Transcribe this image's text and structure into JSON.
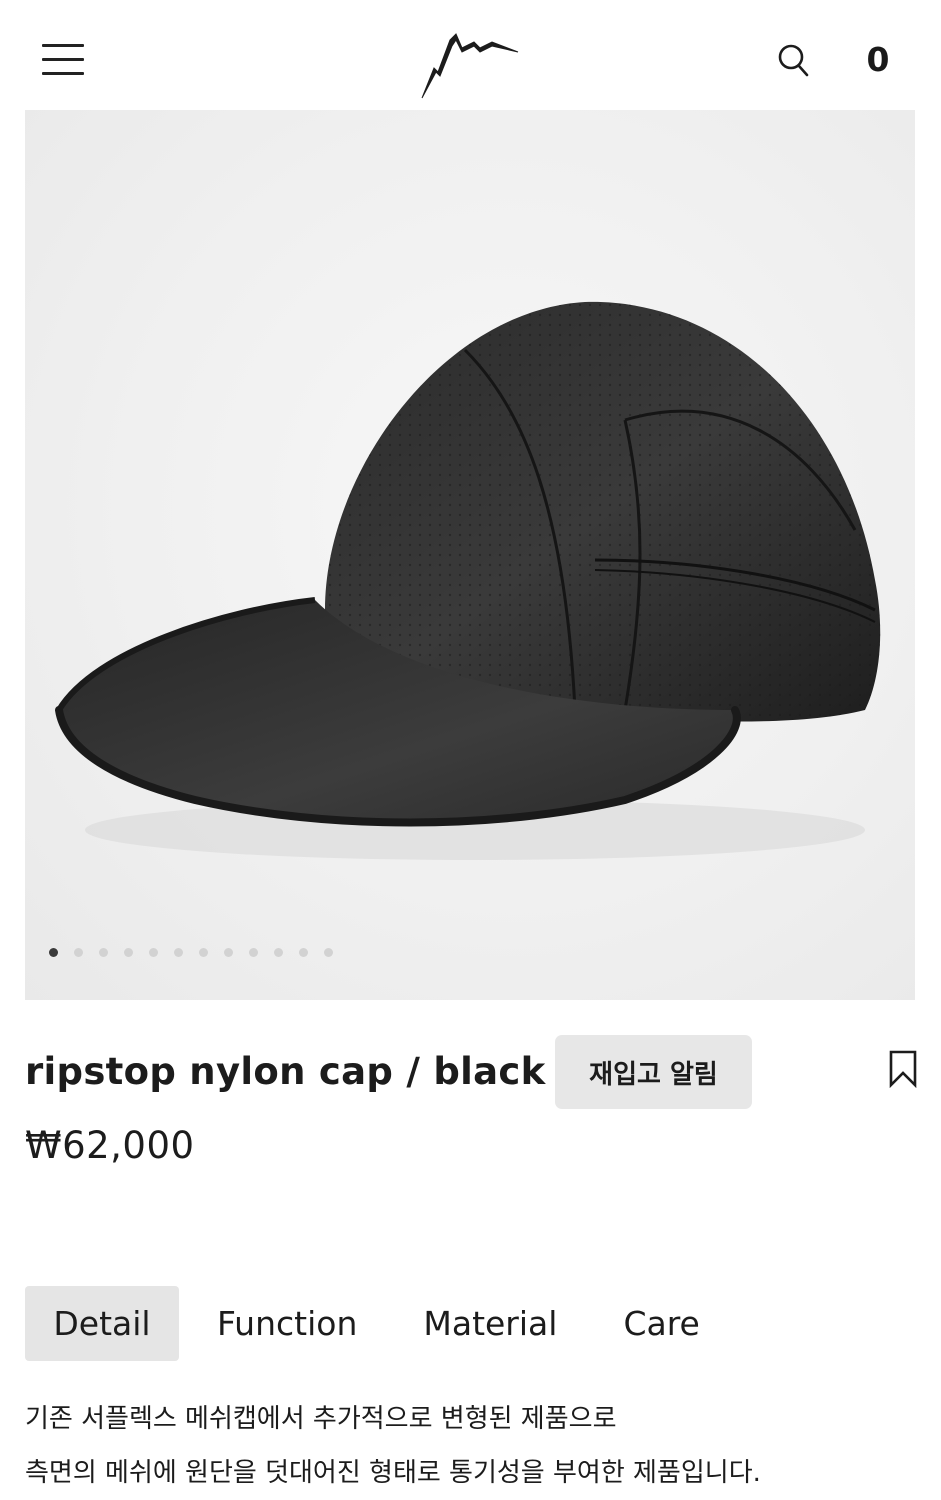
{
  "header": {
    "menu_icon": "hamburger-menu-icon",
    "logo_icon": "mountain-logo-icon",
    "search_icon": "search-icon",
    "cart_count": "0"
  },
  "product": {
    "image_alt": "black ripstop nylon cap",
    "carousel_total": 12,
    "carousel_active": 1,
    "title": "ripstop nylon cap / black",
    "restock_label": "재입고 알림",
    "bookmark_icon": "bookmark-icon",
    "price": "₩62,000"
  },
  "tabs": [
    {
      "label": "Detail",
      "active": true
    },
    {
      "label": "Function",
      "active": false
    },
    {
      "label": "Material",
      "active": false
    },
    {
      "label": "Care",
      "active": false
    }
  ],
  "detail": {
    "lines": [
      "기존 서플렉스 메쉬캡에서 추가적으로 변형된 제품으로",
      "측면의 메쉬에 원단을 덧대어진 형태로 통기성을 부여한 제품입니다."
    ]
  },
  "colors": {
    "text": "#1c1c1c",
    "button_bg": "#e7e7e7",
    "active_dot": "#3a3a3a",
    "inactive_dot": "#d2d2d2"
  }
}
